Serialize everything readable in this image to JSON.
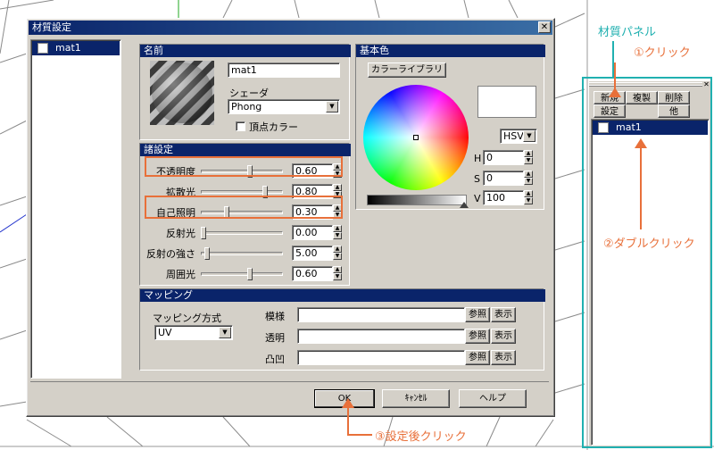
{
  "colors": {
    "highlight": "#e8703a",
    "panel_highlight": "#20b0b0",
    "titlebar": "#0a246a",
    "face": "#d4d0c8"
  },
  "dialog": {
    "title": "材質設定",
    "close_glyph": "✕",
    "material_list": [
      {
        "name": "mat1",
        "selected": true
      }
    ],
    "name_group": {
      "header": "名前",
      "name_value": "mat1",
      "shader_label": "シェーダ",
      "shader_value": "Phong",
      "vertex_color_label": "頂点カラー",
      "vertex_color_checked": false
    },
    "settings_group": {
      "header": "諸設定",
      "rows": [
        {
          "label": "不透明度",
          "value": "0.60",
          "slider_pct": 60
        },
        {
          "label": "拡散光",
          "value": "0.80",
          "slider_pct": 80
        },
        {
          "label": "自己照明",
          "value": "0.30",
          "slider_pct": 30
        },
        {
          "label": "反射光",
          "value": "0.00",
          "slider_pct": 0
        },
        {
          "label": "反射の強さ",
          "value": "5.00",
          "slider_pct": 5
        },
        {
          "label": "周囲光",
          "value": "0.60",
          "slider_pct": 60
        }
      ]
    },
    "basic_color_group": {
      "header": "基本色",
      "library_button": "カラーライブラリ",
      "mode_value": "HSV",
      "h_label": "H",
      "h_value": "0",
      "s_label": "S",
      "s_value": "0",
      "v_label": "V",
      "v_value": "100"
    },
    "mapping_group": {
      "header": "マッピング",
      "method_label": "マッピング方式",
      "method_value": "UV",
      "rows": [
        {
          "label": "模様",
          "value": "",
          "ref_button": "参照",
          "show_button": "表示"
        },
        {
          "label": "透明",
          "value": "",
          "ref_button": "参照",
          "show_button": "表示"
        },
        {
          "label": "凸凹",
          "value": "",
          "ref_button": "参照",
          "show_button": "表示"
        }
      ]
    },
    "buttons": {
      "ok": "OK",
      "cancel": "ｷｬﾝｾﾙ",
      "help": "ヘルプ"
    }
  },
  "material_panel": {
    "label": "材質パネル",
    "close_glyph": "✕",
    "buttons": {
      "new": "新規",
      "duplicate": "複製",
      "delete": "削除",
      "settings": "設定",
      "other": "他"
    },
    "items": [
      {
        "name": "mat1",
        "selected": true
      }
    ]
  },
  "annotations": {
    "click1": "①クリック",
    "double_click2": "②ダブルクリック",
    "after_click3": "③設定後クリック"
  }
}
